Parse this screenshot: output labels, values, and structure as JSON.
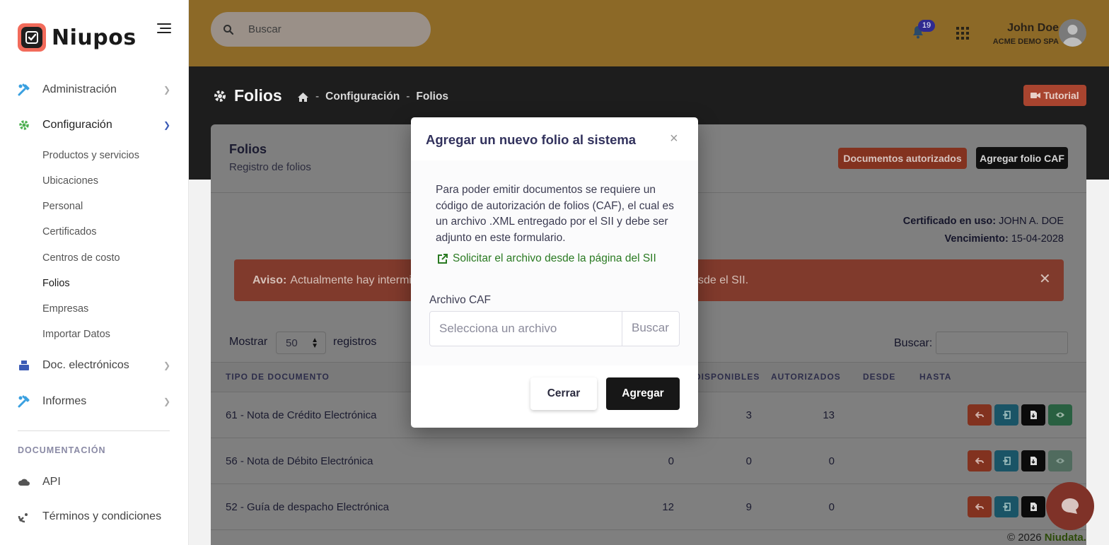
{
  "brand": {
    "name": "Niupos"
  },
  "sidebar": {
    "items": [
      {
        "label": "Administración"
      },
      {
        "label": "Configuración"
      },
      {
        "label": "Doc. electrónicos"
      },
      {
        "label": "Informes"
      }
    ],
    "subitems": [
      {
        "label": "Productos y servicios"
      },
      {
        "label": "Ubicaciones"
      },
      {
        "label": "Personal"
      },
      {
        "label": "Certificados"
      },
      {
        "label": "Centros de costo"
      },
      {
        "label": "Folios"
      },
      {
        "label": "Empresas"
      },
      {
        "label": "Importar Datos"
      }
    ],
    "doc_heading": "DOCUMENTACIÓN",
    "doc_items": [
      {
        "label": "API"
      },
      {
        "label": "Términos y condiciones"
      }
    ]
  },
  "header": {
    "search_placeholder": "Buscar",
    "notifications_count": "19",
    "user_name": "John Doe",
    "user_company": "ACME DEMO SPA"
  },
  "page": {
    "title": "Folios",
    "breadcrumb": [
      "Configuración",
      "Folios"
    ],
    "breadcrumb_sep": "-",
    "tutorial_label": "Tutorial"
  },
  "card": {
    "title": "Folios",
    "subtitle": "Registro de folios",
    "btn_docs": "Documentos autorizados",
    "btn_caf": "Agregar folio CAF",
    "cert_label": "Certificado en uso:",
    "cert_value": "JOHN A. DOE",
    "exp_label": "Vencimiento:",
    "exp_value": "15-04-2028",
    "alert_strong": "Aviso:",
    "alert_text_left": "Actualmente hay intermit",
    "alert_text_right": "sde el SII.",
    "show_label": "Mostrar",
    "show_value": "50",
    "records_label": "registros",
    "search_label": "Buscar:"
  },
  "table": {
    "headers": [
      "TIPO DE DOCUMENTO",
      "DISPONIBLES",
      "AUTORIZADOS",
      "DESDE",
      "HASTA"
    ],
    "rows": [
      {
        "tipo": "61 - Nota de Crédito Electrónica",
        "c1": "",
        "disponibles": "3",
        "autorizados": "13"
      },
      {
        "tipo": "56 - Nota de Débito Electrónica",
        "c1": "0",
        "disponibles": "0",
        "autorizados": "0"
      },
      {
        "tipo": "52 - Guía de despacho Electrónica",
        "c1": "12",
        "disponibles": "9",
        "autorizados": "0"
      }
    ]
  },
  "footer": {
    "copyright": "© 2026",
    "brand": "Niudata."
  },
  "modal": {
    "title": "Agregar un nuevo folio al sistema",
    "close_symbol": "×",
    "description": "Para poder emitir documentos se requiere un código de autorización de folios (CAF), el cual es un archivo .XML entregado por el SII y debe ser adjunto en este formulario.",
    "link_label": "Solicitar el archivo desde la página del SII",
    "field_label": "Archivo CAF",
    "file_placeholder": "Selecciona un archivo",
    "browse_label": "Buscar",
    "cancel_label": "Cerrar",
    "submit_label": "Agregar"
  },
  "colors": {
    "header_bg": "#8c6927",
    "accent_red": "#f26b5b",
    "link_green": "#2a7a22",
    "badge": "#2f2a90"
  }
}
